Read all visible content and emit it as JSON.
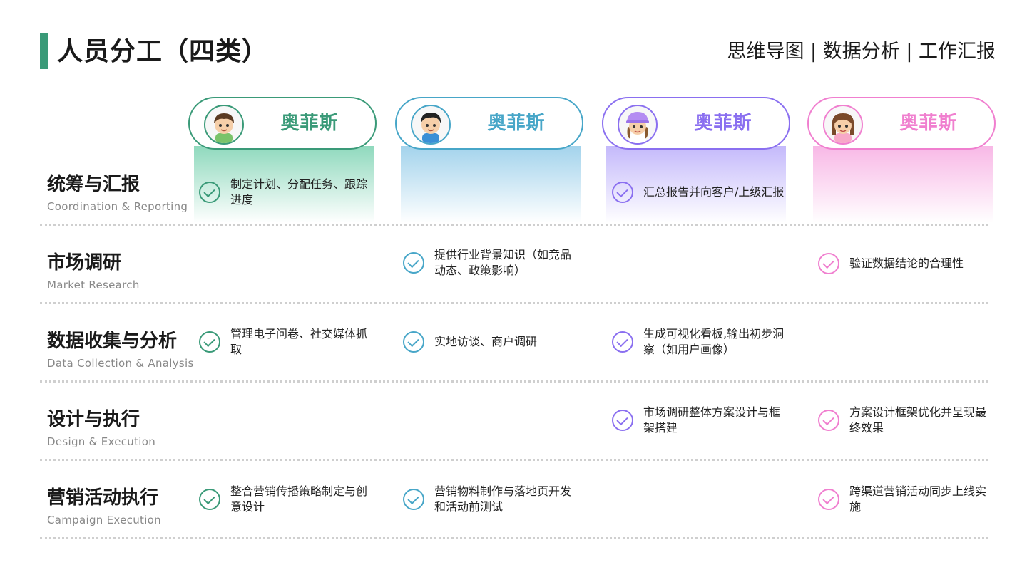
{
  "header": {
    "title": "人员分工（四类）",
    "tagline": "思维导图 | 数据分析 | 工作汇报"
  },
  "colors": {
    "accent_title_bar": "#3a9a78",
    "members": [
      "#3a9a78",
      "#47a6c8",
      "#8a6ff0",
      "#f07fcf"
    ]
  },
  "members": [
    {
      "name": "奥菲斯",
      "avatar": "boy-avatar",
      "color": "#3a9a78"
    },
    {
      "name": "奥菲斯",
      "avatar": "boy-avatar",
      "color": "#47a6c8"
    },
    {
      "name": "奥菲斯",
      "avatar": "girl-cap-avatar",
      "color": "#8a6ff0"
    },
    {
      "name": "奥菲斯",
      "avatar": "girl-avatar",
      "color": "#f07fcf"
    }
  ],
  "rows": [
    {
      "title": "统筹与汇报",
      "subtitle": "Coordination & Reporting",
      "tasks": [
        "制定计划、分配任务、跟踪进度",
        "",
        "汇总报告并向客户/上级汇报",
        ""
      ]
    },
    {
      "title": "市场调研",
      "subtitle": "Market Research",
      "tasks": [
        "",
        "提供行业背景知识（如竞品动态、政策影响）",
        "",
        "验证数据结论的合理性"
      ]
    },
    {
      "title": "数据收集与分析",
      "subtitle": "Data Collection & Analysis",
      "tasks": [
        "管理电子问卷、社交媒体抓取",
        "实地访谈、商户调研",
        "生成可视化看板,输出初步洞察（如用户画像）",
        ""
      ]
    },
    {
      "title": "设计与执行",
      "subtitle": "Design & Execution",
      "tasks": [
        "",
        "",
        "市场调研整体方案设计与框架搭建",
        "方案设计框架优化并呈现最终效果"
      ]
    },
    {
      "title": "营销活动执行",
      "subtitle": "Campaign Execution",
      "tasks": [
        "整合营销传播策略制定与创意设计",
        "营销物料制作与落地页开发和活动前测试",
        "",
        "跨渠道营销活动同步上线实施"
      ]
    }
  ]
}
